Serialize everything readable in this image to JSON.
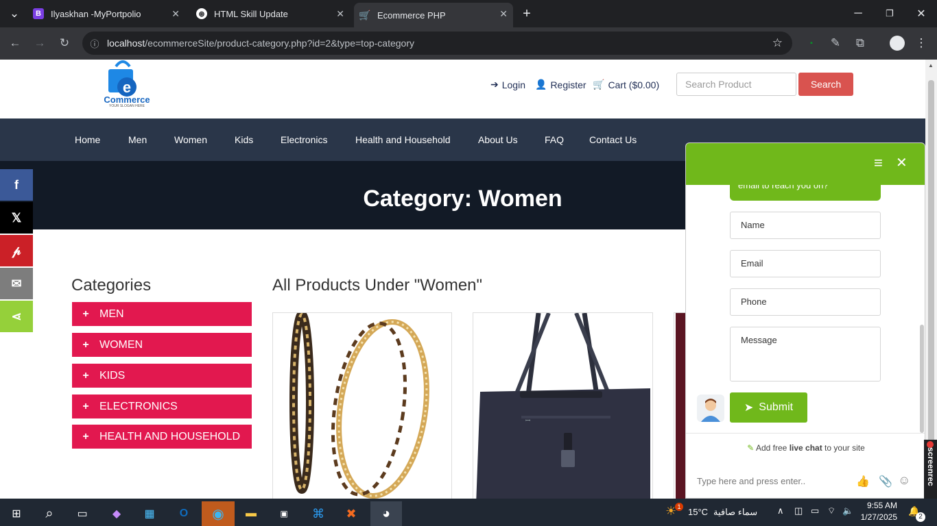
{
  "browser": {
    "tabs": [
      {
        "title": "Ilyaskhan -MyPortpolio"
      },
      {
        "title": "HTML Skill Update"
      },
      {
        "title": "Ecommerce PHP"
      }
    ],
    "url_host": "localhost",
    "url_path": "/ecommerceSite/product-category.php?id=2&type=top-category"
  },
  "header": {
    "logo_text": "Commerce",
    "logo_slogan": "YOUR SLOGAN HERE",
    "login": "Login",
    "register": "Register",
    "cart": "Cart ($0.00)",
    "search_placeholder": "Search Product",
    "search_button": "Search"
  },
  "nav": [
    "Home",
    "Men",
    "Women",
    "Kids",
    "Electronics",
    "Health and Household",
    "About Us",
    "FAQ",
    "Contact Us"
  ],
  "banner_title": "Category: Women",
  "sidebar": {
    "heading": "Categories",
    "items": [
      "MEN",
      "WOMEN",
      "KIDS",
      "ELECTRONICS",
      "HEALTH AND HOUSEHOLD"
    ]
  },
  "products_heading": "All Products Under \"Women\"",
  "share_icons": [
    "facebook-icon",
    "x-icon",
    "pinterest-icon",
    "email-icon",
    "share-icon"
  ],
  "chat": {
    "bubble_text": "email to reach you on?",
    "fields": [
      "Name",
      "Email",
      "Phone",
      "Message"
    ],
    "submit": "Submit",
    "promo_prefix": "Add free ",
    "promo_bold": "live chat",
    "promo_suffix": " to your site",
    "input_placeholder": "Type here and press enter.."
  },
  "taskbar": {
    "weather_temp": "15°C",
    "weather_desc": "سماء صافية",
    "time": "9:55 AM",
    "date": "1/27/2025",
    "notifications": "2",
    "weather_badge": "1"
  },
  "side_watermark": "screenrec",
  "colors": {
    "accent_red": "#e2184f",
    "nav_bg": "#2a3649",
    "chat_green": "#70b81b",
    "search_red": "#d9534f"
  }
}
